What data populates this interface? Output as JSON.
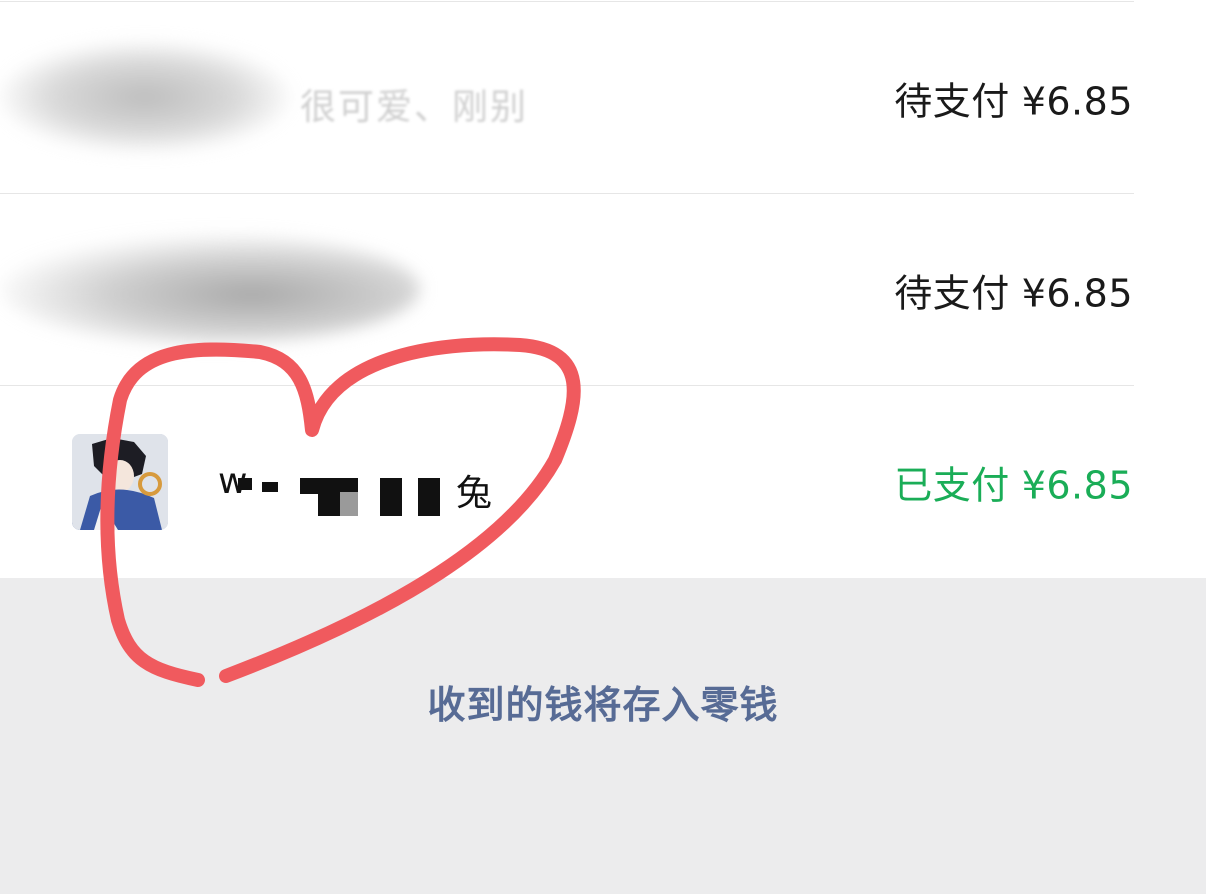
{
  "rows": [
    {
      "name_fragment": "很可爱、刚别",
      "status": "待支付",
      "amount": "¥6.85"
    },
    {
      "name_fragment": "",
      "status": "待支付",
      "amount": "¥6.85"
    },
    {
      "name_start": "w",
      "name_end": "兔",
      "status": "已支付",
      "amount": "¥6.85"
    }
  ],
  "footer": {
    "note": "收到的钱将存入零钱"
  },
  "colors": {
    "pending_text": "#1a1a1a",
    "paid_text": "#1aad57",
    "link_text": "#576b95",
    "footer_bg": "#ececed",
    "annotation": "#f05a5e"
  }
}
